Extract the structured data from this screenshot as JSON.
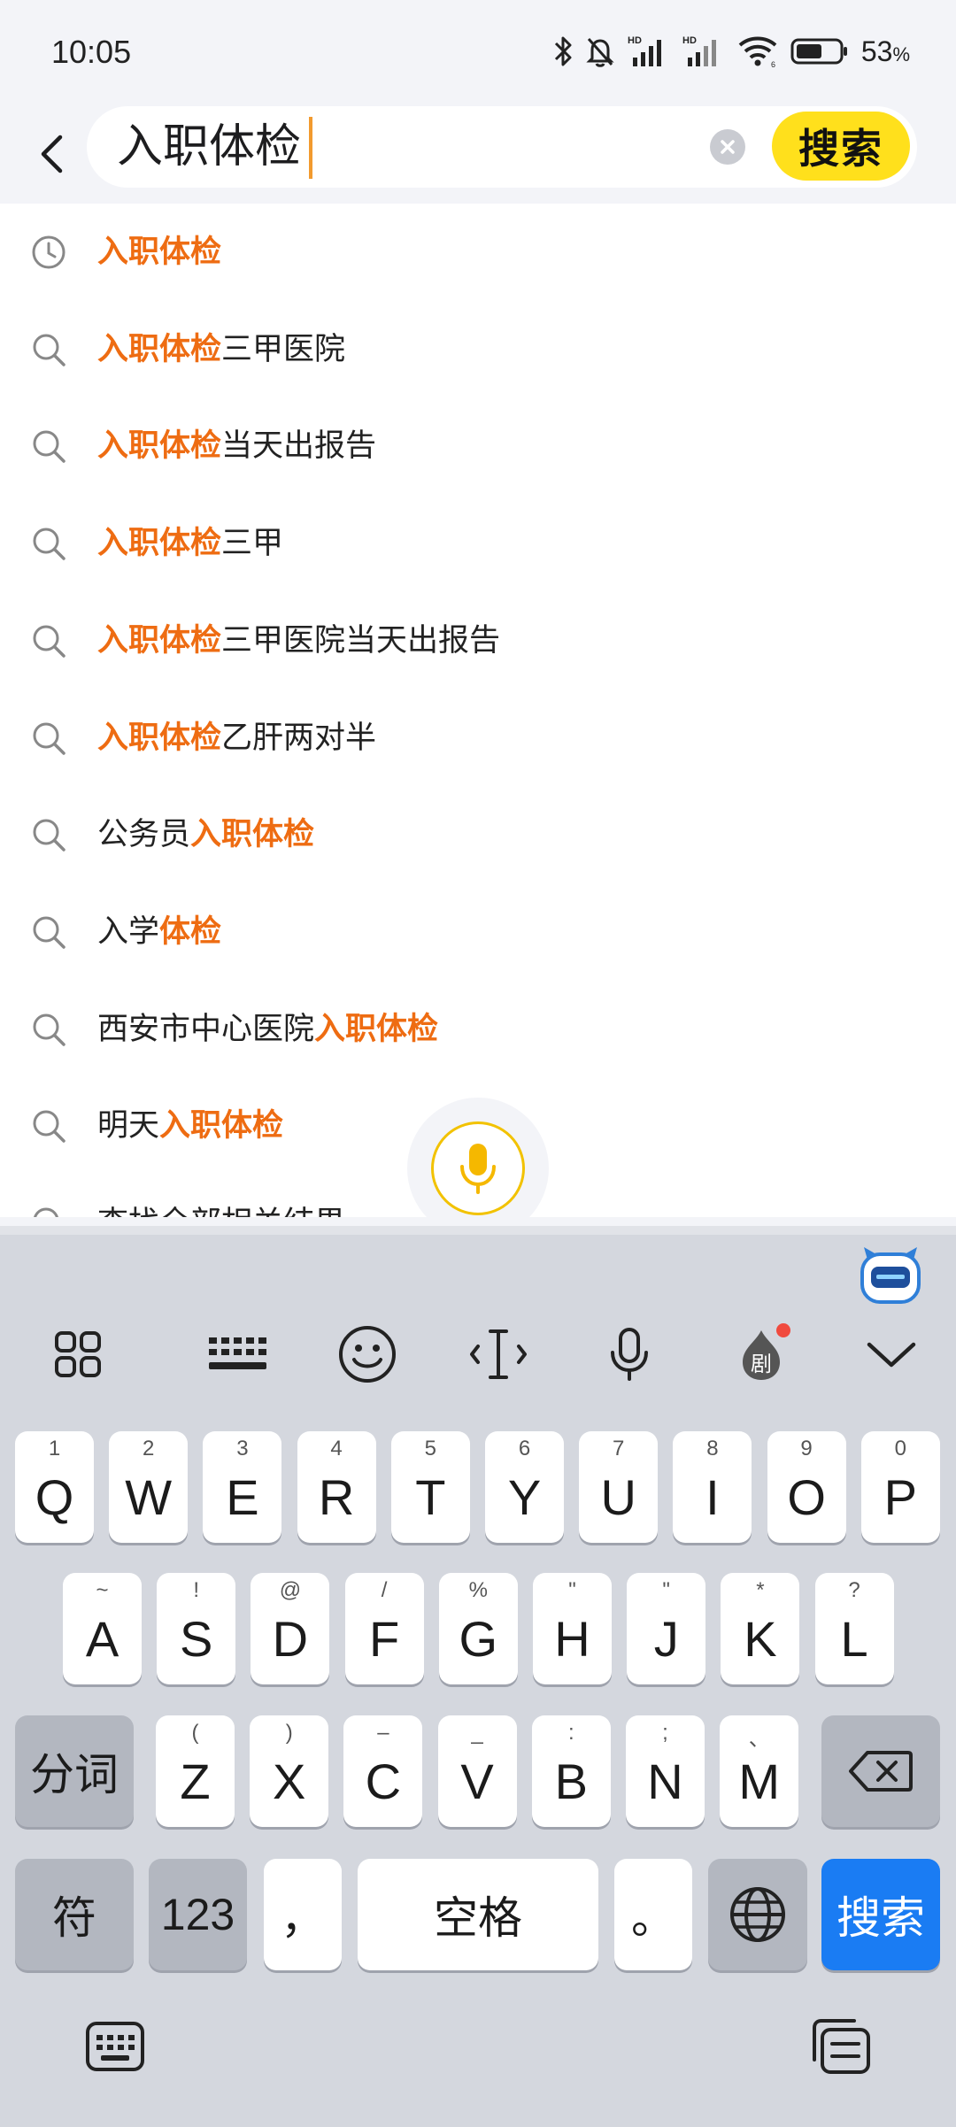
{
  "status_bar": {
    "time": "10:05",
    "battery_percent": "53",
    "battery_unit": "%",
    "icons": [
      "bluetooth-icon",
      "mute-bell-icon",
      "signal-hd-1-icon",
      "signal-hd-2-icon",
      "wifi-icon",
      "battery-icon"
    ]
  },
  "search": {
    "query": "入职体检",
    "button_label": "搜索"
  },
  "suggestions": [
    {
      "type": "history",
      "parts": [
        {
          "t": "入职体检",
          "hl": true
        }
      ]
    },
    {
      "type": "search",
      "parts": [
        {
          "t": "入职体检",
          "hl": true
        },
        {
          "t": "三甲医院",
          "hl": false
        }
      ]
    },
    {
      "type": "search",
      "parts": [
        {
          "t": "入职体检",
          "hl": true
        },
        {
          "t": "当天出报告",
          "hl": false
        }
      ]
    },
    {
      "type": "search",
      "parts": [
        {
          "t": "入职体检",
          "hl": true
        },
        {
          "t": "三甲",
          "hl": false
        }
      ]
    },
    {
      "type": "search",
      "parts": [
        {
          "t": "入职体检",
          "hl": true
        },
        {
          "t": "三甲医院当天出报告",
          "hl": false
        }
      ]
    },
    {
      "type": "search",
      "parts": [
        {
          "t": "入职体检",
          "hl": true
        },
        {
          "t": "乙肝两对半",
          "hl": false
        }
      ]
    },
    {
      "type": "search",
      "parts": [
        {
          "t": "公务员",
          "hl": false
        },
        {
          "t": "入职体检",
          "hl": true
        }
      ]
    },
    {
      "type": "search",
      "parts": [
        {
          "t": "入学",
          "hl": false
        },
        {
          "t": "体检",
          "hl": true
        }
      ]
    },
    {
      "type": "search",
      "parts": [
        {
          "t": "西安市中心医院",
          "hl": false
        },
        {
          "t": "入职体检",
          "hl": true
        }
      ]
    },
    {
      "type": "search",
      "parts": [
        {
          "t": "明天",
          "hl": false
        },
        {
          "t": "入职体检",
          "hl": true
        }
      ]
    },
    {
      "type": "search",
      "parts": [
        {
          "t": "查找全部相关结果",
          "hl": false
        }
      ]
    }
  ],
  "keyboard": {
    "toolbar": [
      "apps-grid-icon",
      "keyboard-layout-icon",
      "emoji-icon",
      "cursor-move-icon",
      "voice-input-icon",
      "drama-icon",
      "collapse-icon"
    ],
    "toolbar_badge_text": "剧",
    "row1": [
      {
        "k": "Q",
        "h": "1"
      },
      {
        "k": "W",
        "h": "2"
      },
      {
        "k": "E",
        "h": "3"
      },
      {
        "k": "R",
        "h": "4"
      },
      {
        "k": "T",
        "h": "5"
      },
      {
        "k": "Y",
        "h": "6"
      },
      {
        "k": "U",
        "h": "7"
      },
      {
        "k": "I",
        "h": "8"
      },
      {
        "k": "O",
        "h": "9"
      },
      {
        "k": "P",
        "h": "0"
      }
    ],
    "row2": [
      {
        "k": "A",
        "h": "~"
      },
      {
        "k": "S",
        "h": "!"
      },
      {
        "k": "D",
        "h": "@"
      },
      {
        "k": "F",
        "h": "/"
      },
      {
        "k": "G",
        "h": "%"
      },
      {
        "k": "H",
        "h": "\""
      },
      {
        "k": "J",
        "h": "\""
      },
      {
        "k": "K",
        "h": "*"
      },
      {
        "k": "L",
        "h": "?"
      }
    ],
    "row3": [
      {
        "k": "Z",
        "h": "("
      },
      {
        "k": "X",
        "h": ")"
      },
      {
        "k": "C",
        "h": "–"
      },
      {
        "k": "V",
        "h": "_"
      },
      {
        "k": "B",
        "h": ":"
      },
      {
        "k": "N",
        "h": ";"
      },
      {
        "k": "M",
        "h": "、"
      }
    ],
    "segment_key": "分词",
    "symbol_key": "符",
    "number_key": "123",
    "comma_key": "，",
    "space_key": "空格",
    "period_key": "。",
    "enter_key": "搜索"
  },
  "colors": {
    "highlight": "#ee6c12",
    "search_button": "#ffe01c",
    "enter_key": "#1a7cf3"
  }
}
